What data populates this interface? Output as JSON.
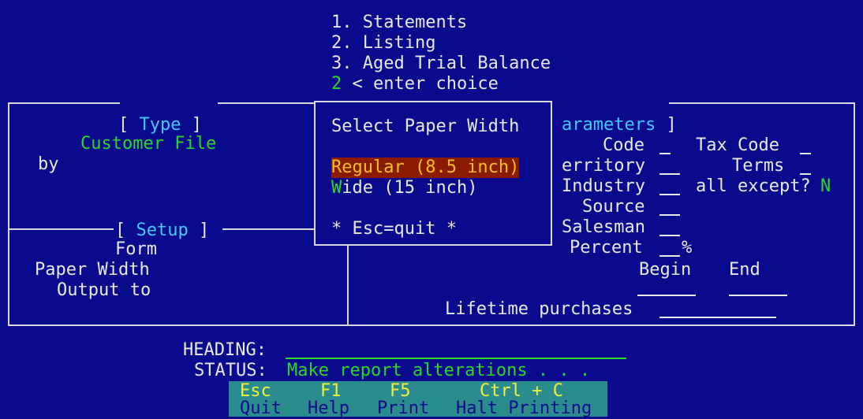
{
  "menu": {
    "items": [
      "1. Statements",
      "2. Listing",
      "3. Aged Trial Balance"
    ],
    "choice_value": "2",
    "choice_prompt": " < enter choice"
  },
  "type_panel": {
    "title": "Type",
    "value": "Customer File",
    "by_label": "by"
  },
  "setup_panel": {
    "title": "Setup",
    "form_label": "Form",
    "paper_width_label": "Paper Width",
    "output_to_label": "Output to"
  },
  "parameters_panel": {
    "title_visible": "arameters",
    "code_label": "Code",
    "tax_code_label": "Tax Code",
    "territory_label": "erritory",
    "terms_label": "Terms",
    "industry_label": "Industry",
    "all_except_label": "all except?",
    "all_except_value": "N",
    "source_label": "Source",
    "salesman_label": "Salesman",
    "percent_label": "Percent",
    "percent_sign": "%",
    "begin_label": "Begin",
    "end_label": "End",
    "lifetime_label": "Lifetime purchases"
  },
  "popup": {
    "title": "Select Paper Width",
    "option_regular": "Regular (8.5 inch)",
    "option_wide_hotkey": "W",
    "option_wide_rest": "ide (15 inch)",
    "quit_hint": "* Esc=quit *"
  },
  "bottom": {
    "heading_label": "HEADING:",
    "status_label": "STATUS:",
    "status_value": "Make report alterations . . ."
  },
  "footer_keys": [
    {
      "key": "Esc",
      "desc": "Quit"
    },
    {
      "key": "F1",
      "desc": "Help"
    },
    {
      "key": "F5",
      "desc": "Print"
    },
    {
      "key": "Ctrl + C",
      "desc": "Halt Printing"
    }
  ],
  "colors": {
    "background": "#0a0a8c",
    "highlight": "#8a1a00",
    "footer": "#2a8c8c",
    "accent_green": "#28d828",
    "accent_cyan": "#40c8ff",
    "accent_yellow": "#f0f040"
  }
}
